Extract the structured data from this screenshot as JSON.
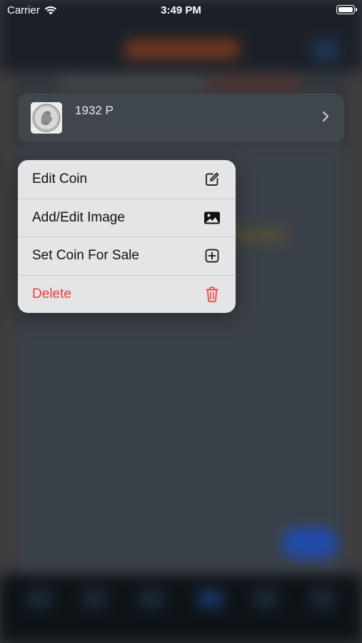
{
  "status_bar": {
    "carrier": "Carrier",
    "time": "3:49 PM",
    "battery_level": 1.0
  },
  "preview": {
    "label": "1932 P",
    "thumbnail_icon": "quarter-coin-image",
    "chevron_icon": "chevron-right-icon"
  },
  "menu": {
    "items": [
      {
        "label": "Edit Coin",
        "icon": "square-pencil-icon",
        "color": "#111111"
      },
      {
        "label": "Add/Edit Image",
        "icon": "photo-icon",
        "color": "#111111"
      },
      {
        "label": "Set Coin For Sale",
        "icon": "plus-square-icon",
        "color": "#111111"
      },
      {
        "label": "Delete",
        "icon": "trash-icon",
        "color": "#e8413f"
      }
    ]
  },
  "colors": {
    "accent_blue": "#1f58d6",
    "destructive": "#e8413f",
    "menu_background": "#e4e5e7"
  }
}
